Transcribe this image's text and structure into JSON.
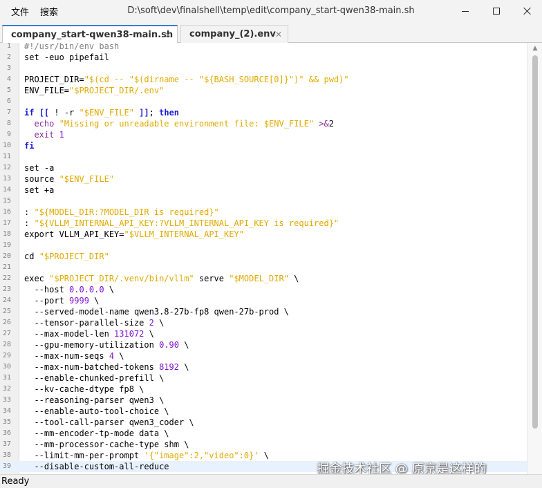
{
  "app": {
    "menu": [
      "文件",
      "搜索"
    ],
    "title": "D:\\soft\\dev\\finalshell\\temp\\edit\\company_start-qwen38-main.sh"
  },
  "window_controls": [
    "minimize",
    "maximize",
    "close"
  ],
  "tabs": [
    {
      "label": "company_start-qwen38-main.sh",
      "close": "✕",
      "active": true
    },
    {
      "label": "company_(2).env",
      "close": "✕",
      "active": false
    }
  ],
  "editor": {
    "language": "bash",
    "current_line": 39,
    "lines": [
      "#!/usr/bin/env bash",
      "set -euo pipefail",
      "",
      "PROJECT_DIR=\"$(cd -- \"$(dirname -- \"${BASH_SOURCE[0]}\")\" && pwd)\"",
      "ENV_FILE=\"$PROJECT_DIR/.env\"",
      "",
      "if [[ ! -r \"$ENV_FILE\" ]]; then",
      "  echo \"Missing or unreadable environment file: $ENV_FILE\" >&2",
      "  exit 1",
      "fi",
      "",
      "set -a",
      "source \"$ENV_FILE\"",
      "set +a",
      "",
      ": \"${MODEL_DIR:?MODEL_DIR is required}\"",
      ": \"${VLLM_INTERNAL_API_KEY:?VLLM_INTERNAL_API_KEY is required}\"",
      "export VLLM_API_KEY=\"$VLLM_INTERNAL_API_KEY\"",
      "",
      "cd \"$PROJECT_DIR\"",
      "",
      "exec \"$PROJECT_DIR/.venv/bin/vllm\" serve \"$MODEL_DIR\" \\",
      "  --host 0.0.0.0 \\",
      "  --port 9999 \\",
      "  --served-model-name qwen3.8-27b-fp8 qwen-27b-prod \\",
      "  --tensor-parallel-size 2 \\",
      "  --max-model-len 131072 \\",
      "  --gpu-memory-utilization 0.90 \\",
      "  --max-num-seqs 4 \\",
      "  --max-num-batched-tokens 8192 \\",
      "  --enable-chunked-prefill \\",
      "  --kv-cache-dtype fp8 \\",
      "  --reasoning-parser qwen3 \\",
      "  --enable-auto-tool-choice \\",
      "  --tool-call-parser qwen3_coder \\",
      "  --mm-encoder-tp-mode data \\",
      "  --mm-processor-cache-type shm \\",
      "  --limit-mm-per-prompt '{\"image\":2,\"video\":0}' \\",
      "  --disable-custom-all-reduce"
    ]
  },
  "watermark": "掘金技术社区 @ 原京是这样的",
  "status": "Ready",
  "colors": {
    "keyword": "#1b1bd6",
    "string": "#e0aa00",
    "number": "#8010d0",
    "comment": "#808080",
    "current_line": "#e8f2fe",
    "tab_accent": "#3a7bd5"
  }
}
